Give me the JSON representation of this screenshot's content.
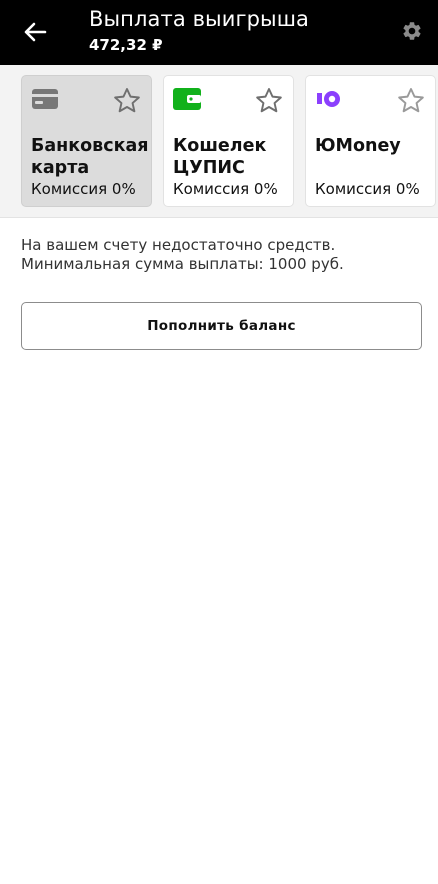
{
  "header": {
    "title": "Выплата выигрыша",
    "balance": "472,32 ₽",
    "back_icon": "arrow-left-icon",
    "settings_icon": "gear-icon",
    "background": "#000000",
    "text_color": "#ffffff"
  },
  "methods": [
    {
      "name": "Банковская\nкарта",
      "commission": "Комиссия 0%",
      "icon": "bank-card-icon",
      "icon_color": "#777777",
      "selected": true
    },
    {
      "name": "Кошелек\nЦУПИС",
      "commission": "Комиссия 0%",
      "icon": "wallet-icon",
      "icon_color": "#11b11b",
      "selected": false
    },
    {
      "name": "ЮMoney",
      "commission": "Комиссия 0%",
      "icon": "yumoney-logo-icon",
      "icon_color": "#8b3ffd",
      "selected": false
    }
  ],
  "message": {
    "line1": "На вашем счету недостаточно средств.",
    "line2": "Минимальная сумма выплаты: 1000 руб."
  },
  "topup_button": {
    "label": "Пополнить баланс"
  }
}
